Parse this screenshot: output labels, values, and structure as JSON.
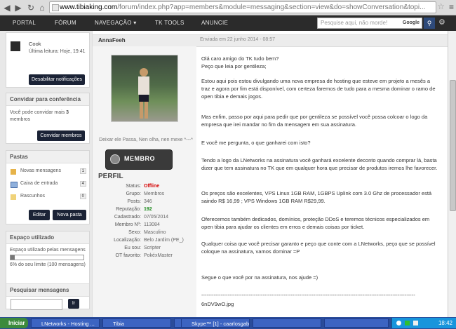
{
  "browser": {
    "url_host": "www.tibiaking.com",
    "url_path": "/forum/index.php?app=members&module=messaging&section=view&do=showConversation&topi..."
  },
  "nav": {
    "items": [
      "PORTAL",
      "FÓRUM",
      "NAVEGAÇÃO ▾",
      "TK TOOLS",
      "ANUNCIE"
    ],
    "search_placeholder": "Pesquise aqui, não morde!",
    "search_provider": "Google"
  },
  "sidebar": {
    "participant": {
      "name": "Cook",
      "last_read": "Última leitura: Hoje, 19:41"
    },
    "disable_notifications": "Desabilitar notificações",
    "invite": {
      "title": "Convidar para conferência",
      "text_pre": "Você pode convidar mais",
      "count": "3",
      "text_post": "membros",
      "button": "Convidar membros"
    },
    "folders": {
      "title": "Pastas",
      "items": [
        {
          "label": "Novas mensagens",
          "count": "1"
        },
        {
          "label": "Caixa de entrada",
          "count": "4"
        },
        {
          "label": "Rascunhos",
          "count": "0"
        }
      ],
      "edit_button": "Editar",
      "new_folder_button": "Nova pasta"
    },
    "space": {
      "title": "Espaço utilizado",
      "label": "Espaço utilizado pelas mensagens",
      "usage_fraction": 0.06,
      "text": "6% do seu limite (100 mensagens)"
    },
    "search": {
      "title": "Pesquisar mensagens",
      "button": "Ir"
    }
  },
  "post": {
    "author": "AnnaFeeh",
    "date": "Enviada em 22 junho 2014 - 08:57",
    "quote": "Deixar ele Passa, Nen olha, nen mexe *---*",
    "rank": "MEMBRO",
    "profile_title": "PERFIL",
    "profile": [
      {
        "k": "Status:",
        "v": "Offline",
        "type": "offline"
      },
      {
        "k": "Grupo:",
        "v": "Membros",
        "type": ""
      },
      {
        "k": "Posts:",
        "v": "346",
        "type": ""
      },
      {
        "k": "Reputação:",
        "v": "192",
        "type": "rep"
      },
      {
        "k": "Cadastrado:",
        "v": "07/05/2014",
        "type": ""
      },
      {
        "k": "Membro Nº:",
        "v": "113084",
        "type": ""
      },
      {
        "k": "Sexo:",
        "v": "Masculino",
        "type": ""
      },
      {
        "k": "Localização:",
        "v": "Belo Jardim (PE_)",
        "type": ""
      },
      {
        "k": "Eu sou:",
        "v": "Scripter",
        "type": ""
      },
      {
        "k": "OT favorito:",
        "v": "PokéxMaster",
        "type": ""
      }
    ],
    "body": [
      "Olá caro amigo do TK tudo bem?",
      "Peço que leia por gentileza;",
      "Estou aqui pois estou divulgando uma nova empresa de hosting que esteve em projeto a mesês a traz e agora por fim está disponível, com certeza faremos de tudo para a mesma dominar o ramo de open tibia e demais jogos.",
      "Mas enfim, passo por aqui para pedir que por gentileza se possível você possa colcoar o logo da empresa que irei mandar no fim da mensagem em sua assinatura.",
      "E você me pergunta, o que ganharei com isto?",
      "Tendo a logo da LNetworks na assinatura você ganhará excelente deconto quando comprar lá, basta dizer que tem assinatura no TK que em qualquer hora que precisar de produtos iremos lhe favorecer.",
      "Os preços são excelentes, VPS Linux 1GB RAM, 1GBPS Uplink com 3.0 Ghz de processador está saindo R$ 16,99 ; VPS Windows 1GB RAM R$29,99.",
      "Oferecemos também dedicados, domínios, proteção DDoS e teremos técnicos especializados em open tibia para ajudar os clientes em erros e demais coisas por ticket.",
      "Qualquer coisa que você precisar garanto e peço que conte com a LNetworks, peço que se possível coloque na assinatura, vamos dominar =P",
      "Segue o que você por na assinatura, nos ajude =)",
      "--------------------------------------------------------------------------------------------------------------------------",
      "6nDV9wO.jpg"
    ]
  },
  "taskbar": {
    "start": "Iniciar",
    "tasks": [
      "LNetworks - Hosting ...",
      "Tibia",
      "",
      "Skype™ [1] - caarlosgabri...",
      "",
      ""
    ],
    "clock": "18:42"
  },
  "colors": {
    "dark_button": "#1b2336",
    "offline": "#d40000",
    "reputation": "#1b8a1b",
    "nav_bg": "#2b2b2b"
  }
}
